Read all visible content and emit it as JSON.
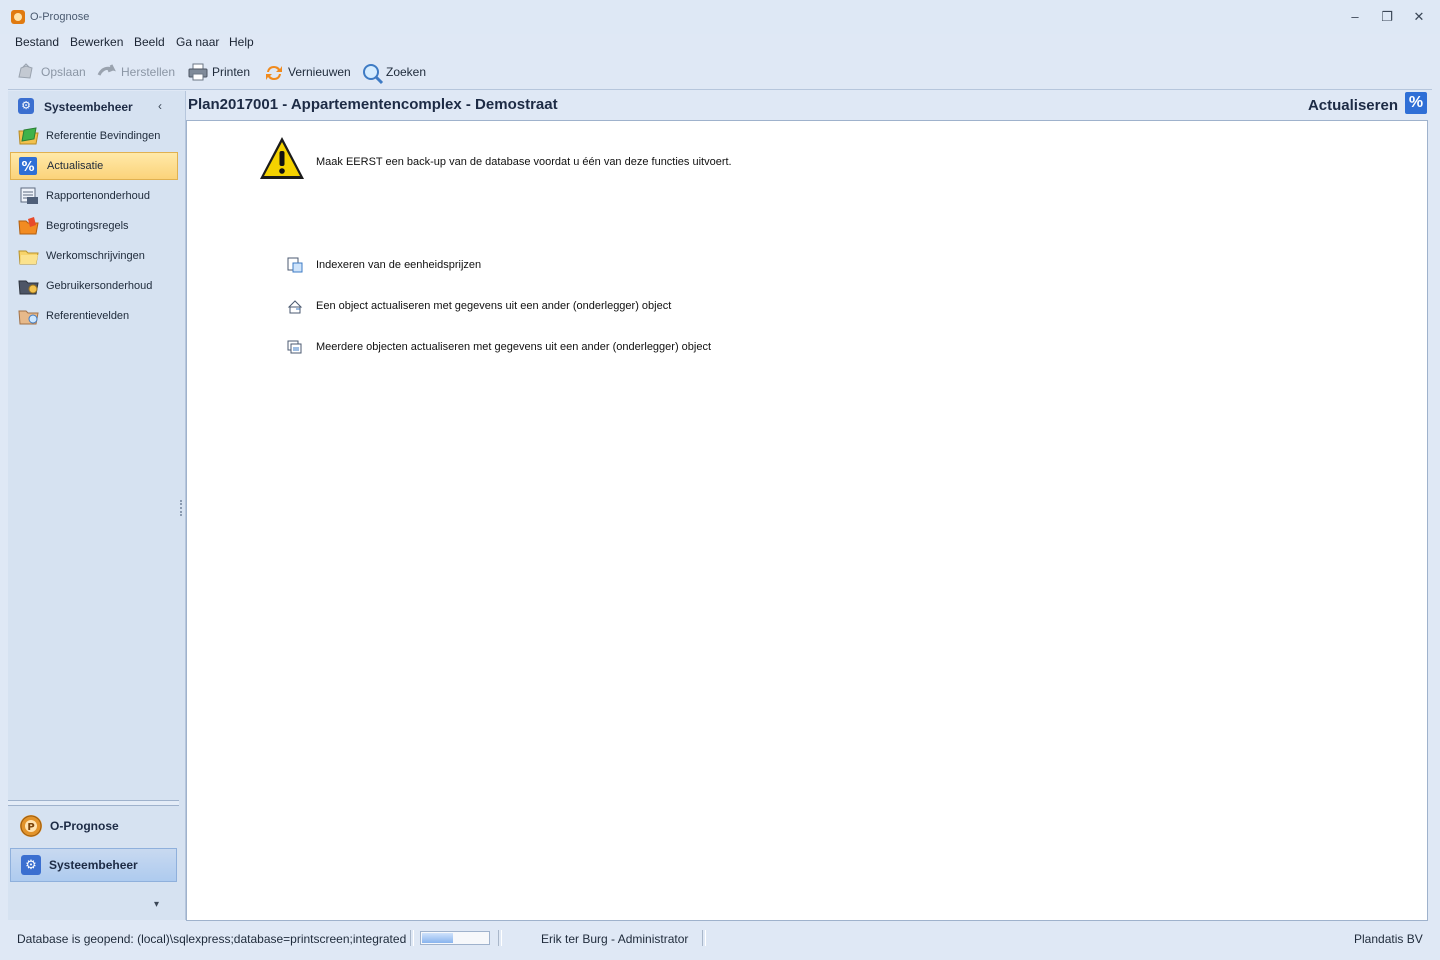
{
  "window": {
    "title": "O-Prognose"
  },
  "menu": {
    "items": [
      "Bestand",
      "Bewerken",
      "Beeld",
      "Ga naar",
      "Help"
    ]
  },
  "toolbar": {
    "save_label": "Opslaan",
    "restore_label": "Herstellen",
    "print_label": "Printen",
    "refresh_label": "Vernieuwen",
    "search_label": "Zoeken"
  },
  "sidebar": {
    "header": "Systeembeheer",
    "items": [
      {
        "label": "Referentie Bevindingen",
        "icon": "green-flag-folder-icon"
      },
      {
        "label": "Actualisatie",
        "icon": "percent-icon"
      },
      {
        "label": "Rapportenonderhoud",
        "icon": "report-folder-icon"
      },
      {
        "label": "Begrotingsregels",
        "icon": "orange-folder-icon"
      },
      {
        "label": "Werkomschrijvingen",
        "icon": "yellow-folder-icon"
      },
      {
        "label": "Gebruikersonderhoud",
        "icon": "user-folder-icon"
      },
      {
        "label": "Referentievelden",
        "icon": "search-folder-icon"
      }
    ],
    "groups": [
      {
        "label": "O-Prognose",
        "icon": "o-prognose-logo-icon"
      },
      {
        "label": "Systeembeheer",
        "icon": "gear-icon"
      }
    ]
  },
  "content": {
    "title": "Plan2017001 - Appartementencomplex - Demostraat",
    "section": "Actualiseren",
    "section_icon": "%",
    "warning": "Maak EERST een back-up van de database voordat u één van deze functies uitvoert.",
    "actions": [
      "Indexeren van de eenheidsprijzen",
      "Een object actualiseren met gegevens uit een ander (onderlegger) object",
      "Meerdere objecten actualiseren met gegevens uit een ander (onderlegger) object"
    ]
  },
  "status": {
    "database": "Database is geopend: (local)\\sqlexpress;database=printscreen;integrated",
    "progress_fraction": 0.45,
    "user": "Erik ter Burg - Administrator",
    "company": "Plandatis BV"
  },
  "colors": {
    "accent": "#2f6fd6",
    "selection": "#fbd37a",
    "warning": "#f4d200"
  }
}
